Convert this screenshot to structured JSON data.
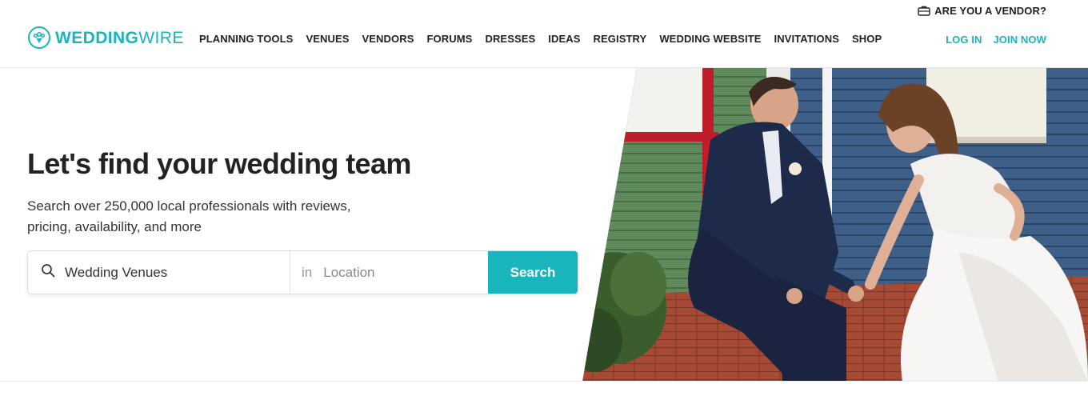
{
  "header": {
    "vendor_link": "ARE YOU A VENDOR?",
    "logo": {
      "part1": "WEDDING",
      "part2": "WIRE"
    },
    "nav": [
      "PLANNING TOOLS",
      "VENUES",
      "VENDORS",
      "FORUMS",
      "DRESSES",
      "IDEAS",
      "REGISTRY",
      "WEDDING WEBSITE",
      "INVITATIONS",
      "SHOP"
    ],
    "login": "LOG IN",
    "join": "JOIN NOW"
  },
  "hero": {
    "title": "Let's find your wedding team",
    "subtitle": "Search over 250,000 local professionals with reviews, pricing, availability, and more",
    "search": {
      "query": "Wedding Venues",
      "in_label": "in",
      "location_placeholder": "Location",
      "button": "Search"
    }
  },
  "colors": {
    "accent": "#19b5bc",
    "text": "#222222"
  },
  "icons": [
    "briefcase-icon",
    "logo-bouquet-icon",
    "search-icon"
  ]
}
